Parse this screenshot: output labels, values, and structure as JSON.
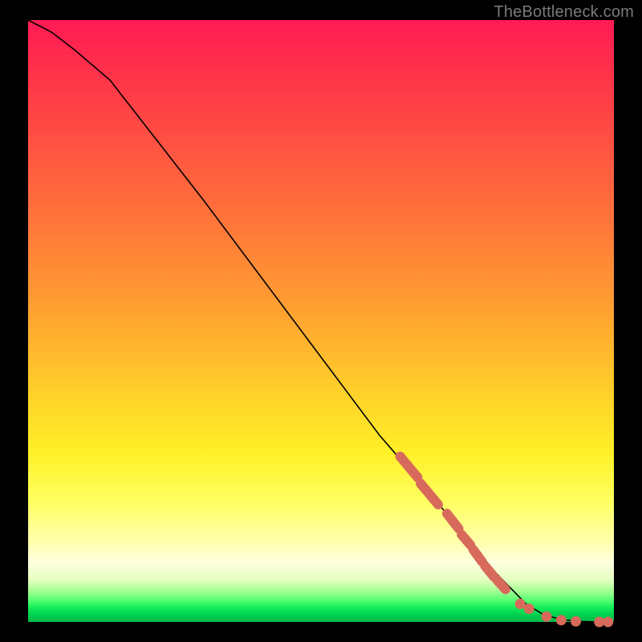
{
  "watermark": "TheBottleneck.com",
  "chart_data": {
    "type": "line",
    "title": "",
    "xlabel": "",
    "ylabel": "",
    "xlim": [
      0,
      100
    ],
    "ylim": [
      0,
      100
    ],
    "curve": {
      "x": [
        0,
        4,
        8,
        14,
        22,
        30,
        40,
        50,
        60,
        68,
        74,
        80,
        85,
        88,
        91,
        94,
        97,
        100
      ],
      "y": [
        100,
        98,
        95,
        90,
        80,
        70,
        57,
        44,
        31,
        22,
        15,
        8,
        3,
        1.2,
        0.4,
        0.1,
        0,
        0
      ]
    },
    "markers": {
      "segments": [
        {
          "x1": 63.5,
          "y1": 27.5,
          "x2": 66.5,
          "y2": 24.0
        },
        {
          "x1": 67.0,
          "y1": 23.0,
          "x2": 70.0,
          "y2": 19.5
        },
        {
          "x1": 71.5,
          "y1": 18.0,
          "x2": 73.5,
          "y2": 15.5
        },
        {
          "x1": 74.0,
          "y1": 14.5,
          "x2": 75.5,
          "y2": 12.8
        },
        {
          "x1": 76.0,
          "y1": 12.0,
          "x2": 77.5,
          "y2": 10.0
        },
        {
          "x1": 78.0,
          "y1": 9.3,
          "x2": 79.5,
          "y2": 7.5
        },
        {
          "x1": 80.0,
          "y1": 7.0,
          "x2": 81.5,
          "y2": 5.4
        }
      ],
      "points": [
        {
          "x": 84.0,
          "y": 3.0
        },
        {
          "x": 85.5,
          "y": 2.2
        },
        {
          "x": 88.5,
          "y": 0.9
        },
        {
          "x": 91.0,
          "y": 0.3
        },
        {
          "x": 93.5,
          "y": 0.1
        },
        {
          "x": 97.5,
          "y": 0.0
        },
        {
          "x": 99.0,
          "y": 0.0
        }
      ]
    }
  }
}
